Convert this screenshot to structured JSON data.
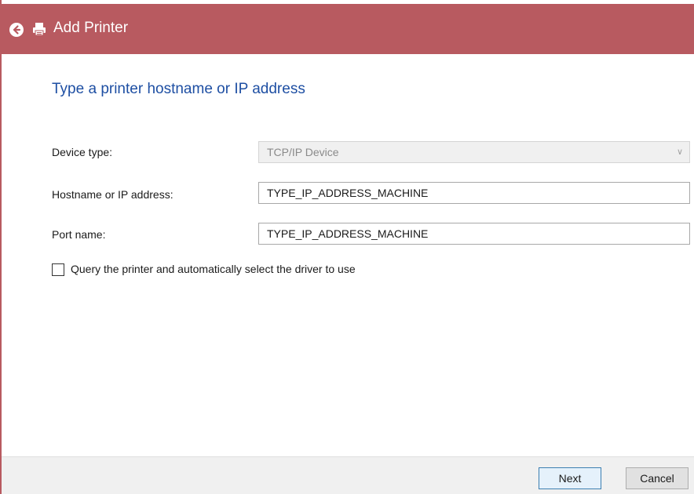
{
  "window": {
    "title": "Add Printer",
    "accent_color": "#b85a60"
  },
  "icons": {
    "back": "back-arrow-icon",
    "printer": "printer-icon",
    "dropdown": "chevron-down-icon"
  },
  "main": {
    "heading": "Type a printer hostname or IP address",
    "device_type": {
      "label": "Device type:",
      "value": "TCP/IP Device"
    },
    "hostname": {
      "label": "Hostname or IP address:",
      "value": "TYPE_IP_ADDRESS_MACHINE"
    },
    "port_name": {
      "label": "Port name:",
      "value": "TYPE_IP_ADDRESS_MACHINE"
    },
    "query_checkbox": {
      "label": "Query the printer and automatically select the driver to use",
      "checked": false
    }
  },
  "footer": {
    "next_label": "Next",
    "cancel_label": "Cancel"
  }
}
